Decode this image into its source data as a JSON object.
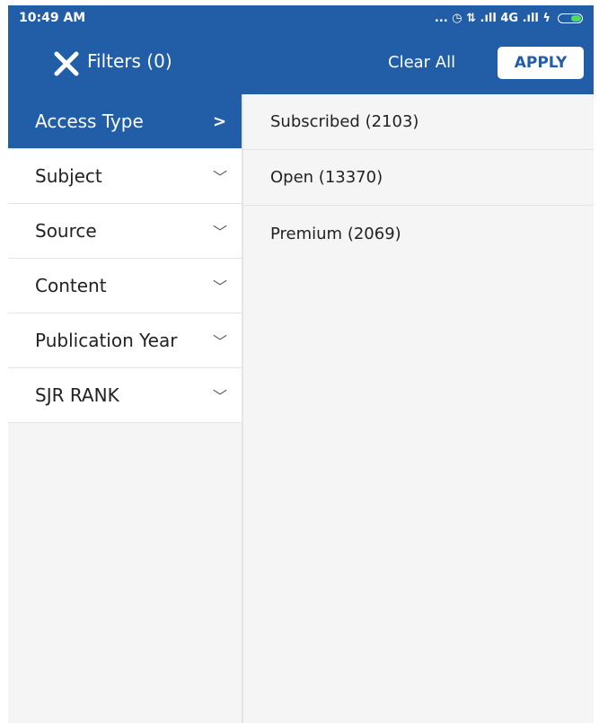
{
  "status_bar": {
    "time": "10:49 AM",
    "indicators": "... ◷ ⇅ .ıll 4G .ıll ϟ"
  },
  "header": {
    "close_icon": "close-icon",
    "title": "Filters (0)",
    "clear_all_label": "Clear All",
    "apply_label": "APPLY",
    "accent_color": "#225ea8"
  },
  "sidebar": {
    "items": [
      {
        "label": "Access Type",
        "chevron": ">",
        "active": true
      },
      {
        "label": "Subject",
        "chevron": "﹀",
        "active": false
      },
      {
        "label": "Source",
        "chevron": "﹀",
        "active": false
      },
      {
        "label": "Content",
        "chevron": "﹀",
        "active": false
      },
      {
        "label": "Publication Year",
        "chevron": "﹀",
        "active": false
      },
      {
        "label": "SJR RANK",
        "chevron": "﹀",
        "active": false
      }
    ]
  },
  "options": {
    "items": [
      {
        "label": "Subscribed (2103)"
      },
      {
        "label": "Open (13370)"
      },
      {
        "label": "Premium (2069)"
      }
    ]
  }
}
